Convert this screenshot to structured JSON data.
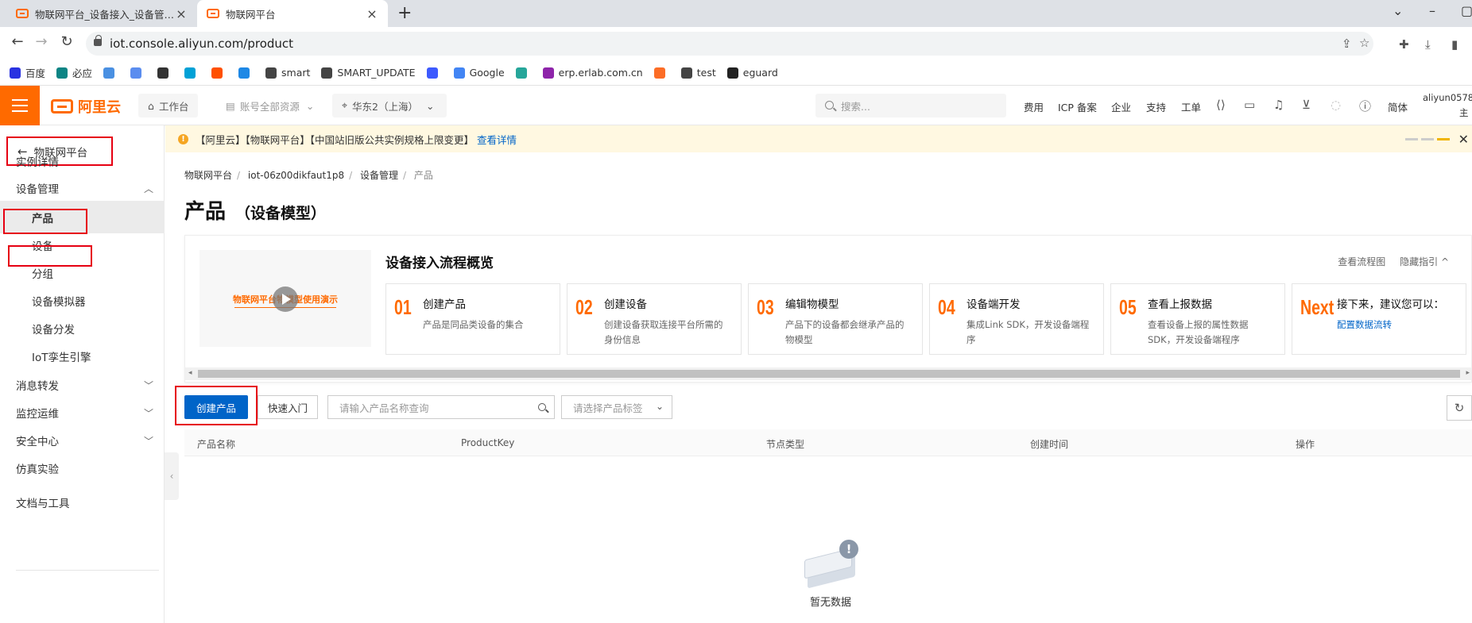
{
  "browser": {
    "tabs": [
      {
        "title": "物联网平台_设备接入_设备管理_",
        "active": false
      },
      {
        "title": "物联网平台",
        "active": true
      }
    ],
    "url": "iot.console.aliyun.com/product",
    "bookmarks": [
      {
        "label": "百度",
        "icon": "baidu-icon",
        "color": "#2932e1"
      },
      {
        "label": "必应",
        "icon": "bing-icon",
        "color": "#0c8484"
      },
      {
        "label": "",
        "icon": "translate-icon",
        "color": "#4a90e2"
      },
      {
        "label": "",
        "icon": "bookmark-icon",
        "color": "#5b8def"
      },
      {
        "label": "",
        "icon": "bookmark-icon",
        "color": "#333333"
      },
      {
        "label": "",
        "icon": "bilibili-icon",
        "color": "#00a1d6"
      },
      {
        "label": "",
        "icon": "taobao-icon",
        "color": "#ff5000"
      },
      {
        "label": "",
        "icon": "shield-icon",
        "color": "#1e88e5"
      },
      {
        "label": "smart",
        "icon": "globe-icon",
        "color": "#444444"
      },
      {
        "label": "SMART_UPDATE",
        "icon": "globe-icon",
        "color": "#444444"
      },
      {
        "label": "",
        "icon": "diamond-icon",
        "color": "#3d5afe"
      },
      {
        "label": "Google",
        "icon": "google-icon",
        "color": "#4285f4"
      },
      {
        "label": "",
        "icon": "snowflake-icon",
        "color": "#26a69a"
      },
      {
        "label": "erp.erlab.com.cn",
        "icon": "ring-icon",
        "color": "#8e24aa"
      },
      {
        "label": "",
        "icon": "gitlab-icon",
        "color": "#fc6d26"
      },
      {
        "label": "test",
        "icon": "globe-icon",
        "color": "#444444"
      },
      {
        "label": "eguard",
        "icon": "eguard-icon",
        "color": "#222222"
      }
    ]
  },
  "header": {
    "logo_text": "阿里云",
    "workbench": "工作台",
    "resource_group": "账号全部资源",
    "region": "华东2（上海）",
    "search_placeholder": "搜索...",
    "nav": [
      "费用",
      "ICP 备案",
      "企业",
      "支持",
      "工单"
    ],
    "lang": "简体",
    "account": "aliyun0578",
    "account_sub": "主"
  },
  "sidebar": {
    "back_label": "物联网平台",
    "items": [
      {
        "label": "实例详情",
        "level": 1
      },
      {
        "label": "设备管理",
        "level": 1,
        "chevron": "up"
      },
      {
        "label": "产品",
        "level": 2,
        "selected": true
      },
      {
        "label": "设备",
        "level": 2
      },
      {
        "label": "分组",
        "level": 2
      },
      {
        "label": "设备模拟器",
        "level": 2
      },
      {
        "label": "设备分发",
        "level": 2
      },
      {
        "label": "IoT孪生引擎",
        "level": 2
      },
      {
        "label": "消息转发",
        "level": 1,
        "chevron": "down"
      },
      {
        "label": "监控运维",
        "level": 1,
        "chevron": "down"
      },
      {
        "label": "安全中心",
        "level": 1,
        "chevron": "down"
      },
      {
        "label": "仿真实验",
        "level": 1
      },
      {
        "label": "文档与工具",
        "level": 1
      }
    ]
  },
  "notice": {
    "text": "【阿里云】【物联网平台】【中国站旧版公共实例规格上限变更】",
    "link": "查看详情"
  },
  "breadcrumb": [
    "物联网平台",
    "iot-06z00dikfaut1p8",
    "设备管理",
    "产品"
  ],
  "page": {
    "title": "产品",
    "subtitle": "（设备模型）"
  },
  "guide": {
    "video_text": "物联网平台物模型使用演示",
    "title": "设备接入流程概览",
    "links": [
      "查看流程图",
      "隐藏指引 ^"
    ],
    "steps": [
      {
        "num": "01",
        "title": "创建产品",
        "desc": "产品是同品类设备的集合"
      },
      {
        "num": "02",
        "title": "创建设备",
        "desc": "创建设备获取连接平台所需的身份信息"
      },
      {
        "num": "03",
        "title": "编辑物模型",
        "desc": "产品下的设备都会继承产品的物模型"
      },
      {
        "num": "04",
        "title": "设备端开发",
        "desc": "集成Link SDK，开发设备端程序"
      },
      {
        "num": "05",
        "title": "查看上报数据",
        "desc": "查看设备上报的属性数据SDK，开发设备端程序"
      },
      {
        "num": "Next",
        "title": "接下来，建议您可以：",
        "desc": "配置数据流转"
      }
    ]
  },
  "toolbar": {
    "create_label": "创建产品",
    "quickstart_label": "快速入门",
    "search_placeholder": "请输入产品名称查询",
    "tag_placeholder": "请选择产品标签"
  },
  "table": {
    "columns": [
      "产品名称",
      "ProductKey",
      "节点类型",
      "创建时间",
      "操作"
    ],
    "empty_text": "暂无数据"
  }
}
